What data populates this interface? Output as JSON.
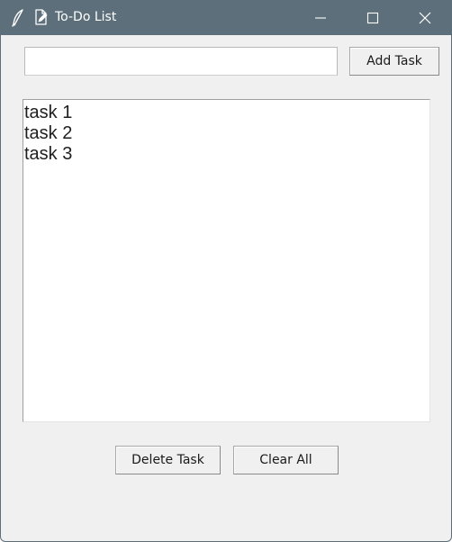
{
  "window": {
    "title": "To-Do List",
    "titlebar_color": "#5d6f7b",
    "background_color": "#f0f0f0",
    "icons": {
      "app": "feather-icon",
      "document": "edit-document-icon",
      "minimize": "minimize-icon",
      "maximize": "maximize-icon",
      "close": "close-icon"
    }
  },
  "entry": {
    "value": "",
    "placeholder": ""
  },
  "buttons": {
    "add_label": "Add Task",
    "delete_label": "Delete Task",
    "clear_label": "Clear All"
  },
  "tasks": [
    "task 1",
    "task 2",
    "task 3"
  ]
}
